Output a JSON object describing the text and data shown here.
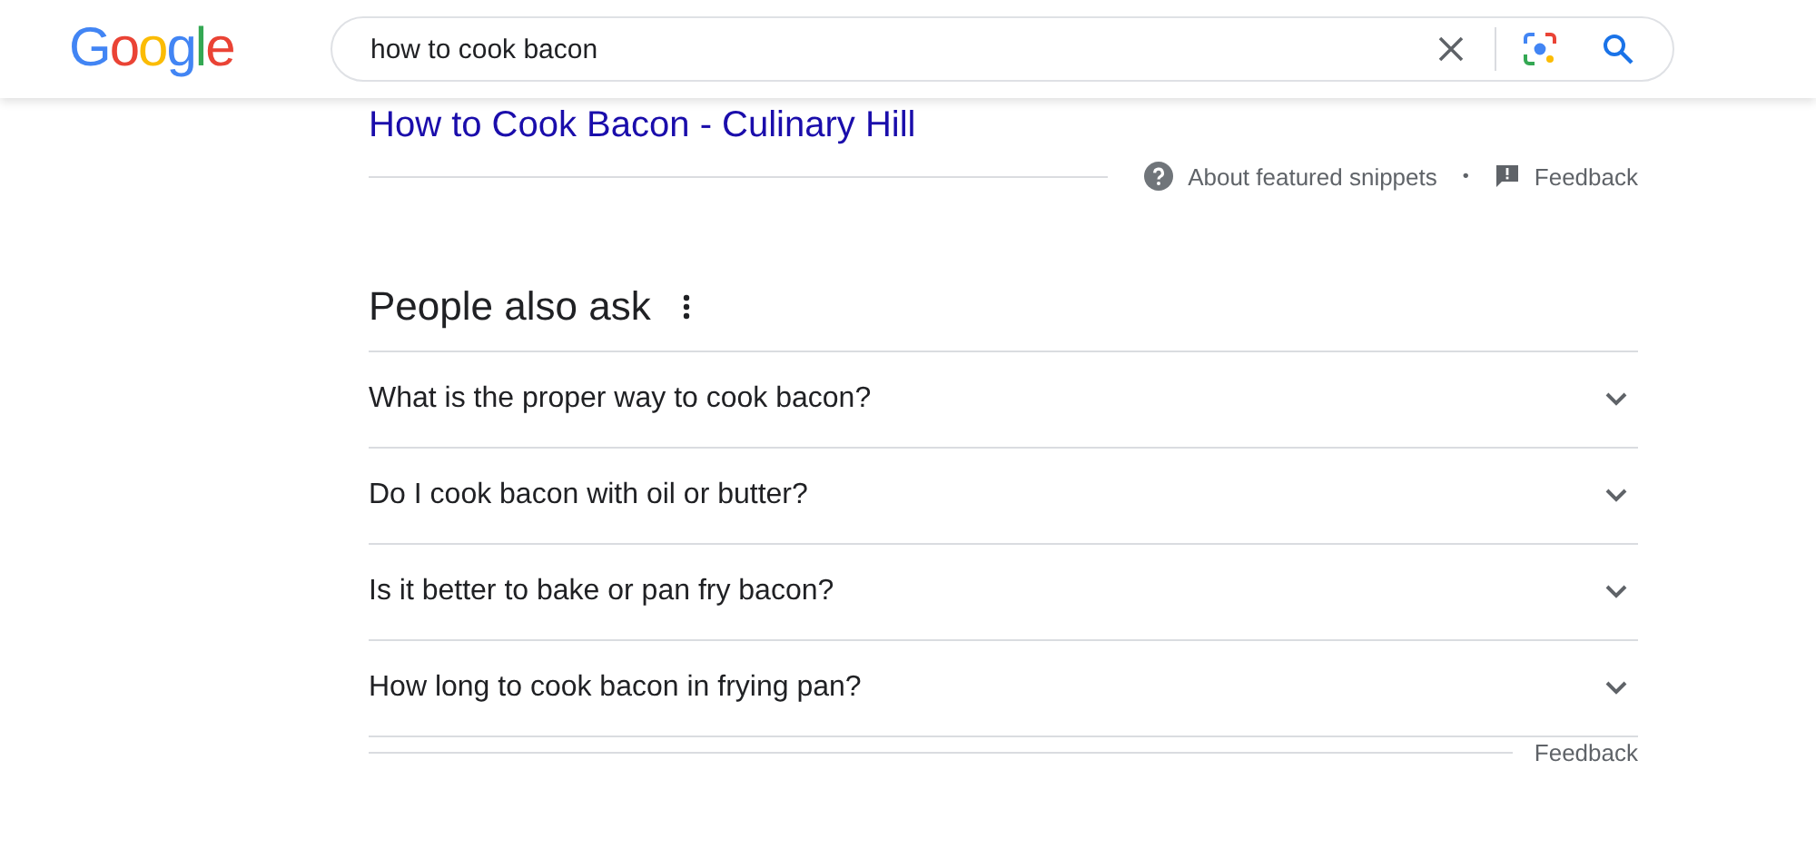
{
  "header": {
    "logo": "Google",
    "search": {
      "value": "how to cook bacon"
    }
  },
  "featured_snippet": {
    "link": "How to Cook Bacon - Culinary Hill",
    "about": "About featured snippets",
    "separator": "•",
    "feedback": "Feedback"
  },
  "people_also_ask": {
    "title": "People also ask",
    "questions": [
      {
        "text": "What is the proper way to cook bacon?",
        "expanded": false
      },
      {
        "text": "Do I cook bacon with oil or butter?",
        "expanded": false
      },
      {
        "text": "Is it better to bake or pan fry bacon?",
        "expanded": false
      },
      {
        "text": "How long to cook bacon in frying pan?",
        "expanded": false
      }
    ],
    "feedback": "Feedback"
  }
}
